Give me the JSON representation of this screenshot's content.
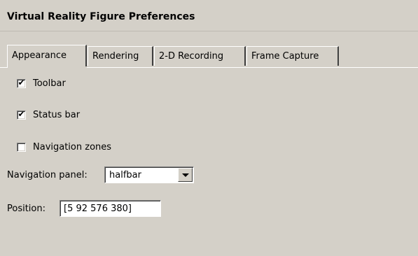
{
  "window": {
    "title": "Virtual Reality Figure Preferences"
  },
  "tabs": [
    {
      "label": "Appearance",
      "active": true
    },
    {
      "label": "Rendering",
      "active": false
    },
    {
      "label": "2-D Recording",
      "active": false
    },
    {
      "label": "Frame Capture",
      "active": false
    }
  ],
  "appearance": {
    "toolbar": {
      "label": "Toolbar",
      "checked": true
    },
    "status_bar": {
      "label": "Status bar",
      "checked": true
    },
    "navigation_zones": {
      "label": "Navigation zones",
      "checked": false
    },
    "navigation_panel": {
      "label": "Navigation panel:",
      "value": "halfbar"
    },
    "position": {
      "label": "Position:",
      "value": "[5 92 576 380]"
    }
  },
  "check_glyph": "✔",
  "colors": {
    "background": "#d4d0c8",
    "field_background": "#ffffff"
  }
}
